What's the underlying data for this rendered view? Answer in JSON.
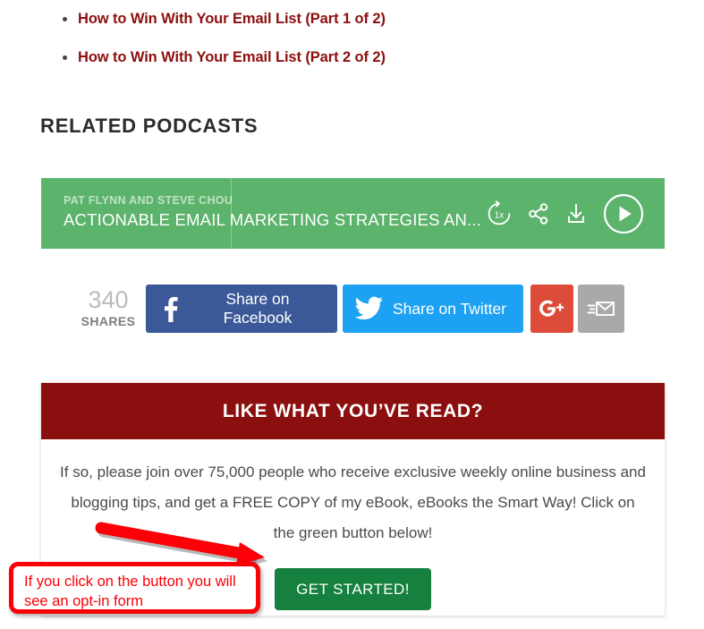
{
  "related_posts": {
    "items": [
      {
        "label": "How to Win With Your Email List (Part 1 of 2)"
      },
      {
        "label": "How to Win With Your Email List (Part 2 of 2)"
      }
    ]
  },
  "section": {
    "heading": "RELATED PODCASTS"
  },
  "podcast_player": {
    "author": "PAT FLYNN AND STEVE CHOU",
    "title": "ACTIONABLE EMAIL MARKETING STRATEGIES AN...",
    "speed_label": "1x",
    "background_color": "#5cb36b",
    "controls": [
      {
        "name": "speed-icon",
        "label": "1x"
      },
      {
        "name": "share-icon",
        "label": "Share"
      },
      {
        "name": "download-icon",
        "label": "Download"
      },
      {
        "name": "play-icon",
        "label": "Play"
      }
    ]
  },
  "share_bar": {
    "count": "340",
    "count_label": "SHARES",
    "buttons": [
      {
        "name": "facebook",
        "label": "Share on Facebook",
        "color": "#3b5998"
      },
      {
        "name": "twitter",
        "label": "Share on Twitter",
        "color": "#1da1f2"
      },
      {
        "name": "googleplus",
        "label": "g+",
        "color": "#dd4b39"
      },
      {
        "name": "email",
        "label": "Email",
        "color": "#a9a9a9"
      }
    ]
  },
  "optin": {
    "heading": "LIKE WHAT YOU’VE READ?",
    "body": "If so, please join over 75,000 people who receive exclusive weekly online business and blogging tips, and get a FREE COPY of my eBook, eBooks the Smart Way! Click on the green button below!",
    "cta_label": "GET STARTED!",
    "header_color": "#8c0f0f",
    "cta_color": "#16803f"
  },
  "annotation": {
    "text": "If you click on the button you will see an opt-in form",
    "color": "#fb0007"
  }
}
